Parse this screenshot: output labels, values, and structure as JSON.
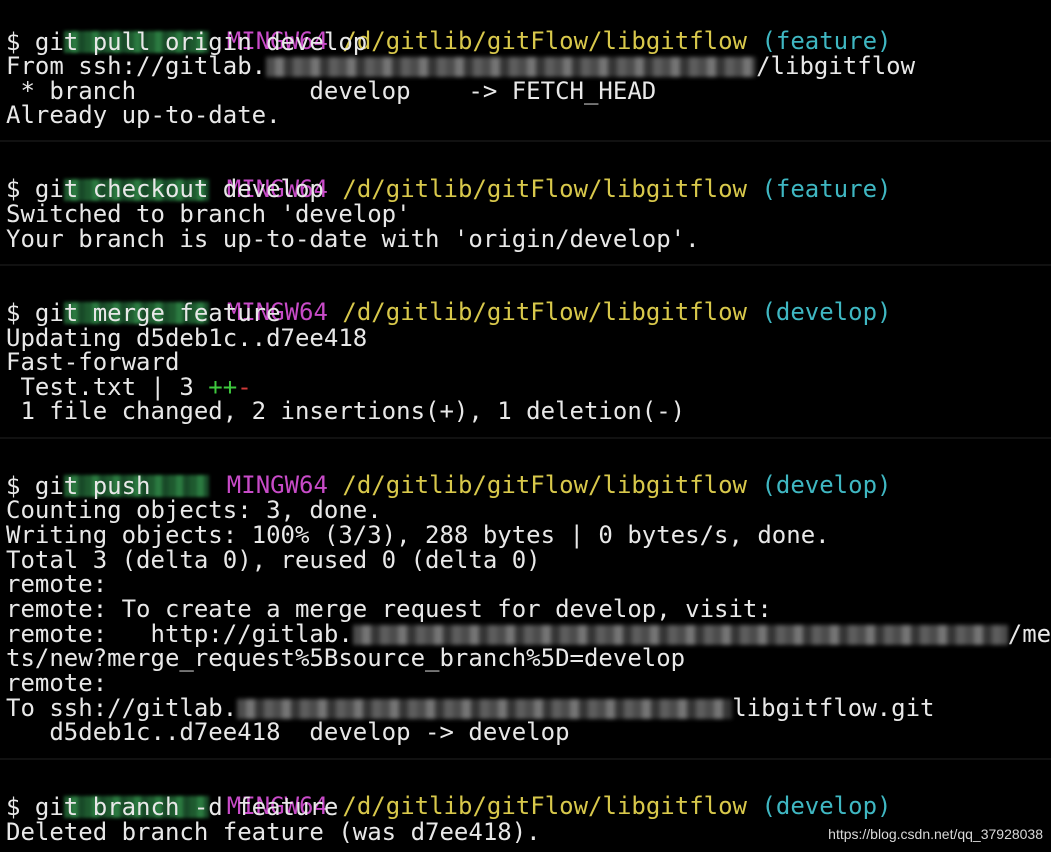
{
  "prompts": [
    {
      "env": "MINGW64",
      "path": "/d/gitlib/gitFlow/libgitflow",
      "branch": "(feature)",
      "command": "$ git pull origin develop"
    },
    {
      "env": "MINGW64",
      "path": "/d/gitlib/gitFlow/libgitflow",
      "branch": "(feature)",
      "command": "$ git checkout develop"
    },
    {
      "env": "MINGW64",
      "path": "/d/gitlib/gitFlow/libgitflow",
      "branch": "(develop)",
      "command": "$ git merge feature"
    },
    {
      "env": "MINGW64",
      "path": "/d/gitlib/gitFlow/libgitflow",
      "branch": "(develop)",
      "command": "$ git push"
    },
    {
      "env": "MINGW64",
      "path": "/d/gitlib/gitFlow/libgitflow",
      "branch": "(develop)",
      "command": "$ git branch -d feature"
    }
  ],
  "output": {
    "pull_from_prefix": "From ssh://gitlab.",
    "pull_from_suffix": "/libgitflow",
    "pull_branch": " * branch            develop    -> FETCH_HEAD",
    "pull_uptodate": "Already up-to-date.",
    "checkout_switched": "Switched to branch 'develop'",
    "checkout_uptodate": "Your branch is up-to-date with 'origin/develop'.",
    "merge_updating": "Updating d5deb1c..d7ee418",
    "merge_ff": "Fast-forward",
    "merge_file": " Test.txt | 3 ",
    "merge_plus": "++",
    "merge_minus": "-",
    "merge_summary": " 1 file changed, 2 insertions(+), 1 deletion(-)",
    "push_counting": "Counting objects: 3, done.",
    "push_writing": "Writing objects: 100% (3/3), 288 bytes | 0 bytes/s, done.",
    "push_total": "Total 3 (delta 0), reused 0 (delta 0)",
    "push_remote1": "remote:",
    "push_remote2": "remote: To create a merge request for develop, visit:",
    "push_remote3_prefix": "remote:   http://gitlab.",
    "push_remote3_suffix": "/me",
    "push_remote4": "ts/new?merge_request%5Bsource_branch%5D=develop",
    "push_remote5": "remote:",
    "push_to_prefix": "To ssh://gitlab.",
    "push_to_suffix": "libgitflow.git",
    "push_refs": "   d5deb1c..d7ee418  develop -> develop",
    "branch_deleted": "Deleted branch feature (was d7ee418)."
  },
  "watermark": "https://blog.csdn.net/qq_37928038"
}
